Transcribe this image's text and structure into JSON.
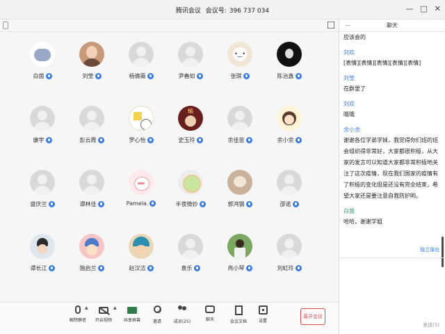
{
  "window": {
    "title_app": "腾讯会议",
    "title_label": "会议号:",
    "meeting_id": "396 737 034",
    "controls": [
      "—",
      "□",
      "✕"
    ]
  },
  "participants": [
    {
      "name": "白茵",
      "avatar": "elephant"
    },
    {
      "name": "刘莹",
      "avatar": "photo"
    },
    {
      "name": "杨倩薇",
      "avatar": "generic"
    },
    {
      "name": "尹春如",
      "avatar": "generic"
    },
    {
      "name": "张琪",
      "avatar": "dog"
    },
    {
      "name": "陈治鑫",
      "avatar": "dark"
    },
    {
      "name": "康宇",
      "avatar": "generic"
    },
    {
      "name": "彭云霞",
      "avatar": "generic"
    },
    {
      "name": "罗心怡",
      "avatar": "sketch"
    },
    {
      "name": "史玉玲",
      "avatar": "poster"
    },
    {
      "name": "余佳苗",
      "avatar": "generic"
    },
    {
      "name": "余小余",
      "avatar": "girlcartoon"
    },
    {
      "name": "盛庆兰",
      "avatar": "generic"
    },
    {
      "name": "谭林佳",
      "avatar": "generic"
    },
    {
      "name": "Pamela.",
      "avatar": "cartoon"
    },
    {
      "name": "半夜微妙",
      "avatar": "melon"
    },
    {
      "name": "郭鸿钢",
      "avatar": "cat"
    },
    {
      "name": "邵诺",
      "avatar": "generic"
    },
    {
      "name": "谭长江",
      "avatar": "boy"
    },
    {
      "name": "施启兰",
      "avatar": "kid"
    },
    {
      "name": "赵汉洁",
      "avatar": "hat"
    },
    {
      "name": "袁乐",
      "avatar": "generic"
    },
    {
      "name": "冉小琴",
      "avatar": "outdoor"
    },
    {
      "name": "刘虹玲",
      "avatar": "generic"
    }
  ],
  "toolbar": {
    "mute": "解除静音",
    "video": "开启视频",
    "share": "共享屏幕",
    "invite": "邀请",
    "members": "成员(25)",
    "chat": "聊天",
    "docs": "会议文档",
    "settings": "设置",
    "leave": "离开会议",
    "caret": "▲"
  },
  "chat": {
    "header": "聊天",
    "minimize": "—",
    "messages": [
      {
        "sender": "",
        "text": "应该会的"
      },
      {
        "sender": "刘欢",
        "text": "[表情][表情][表情][表情][表情]"
      },
      {
        "sender": "刘莹",
        "text": "在群里了"
      },
      {
        "sender": "刘欢",
        "text": "哦哦"
      },
      {
        "sender": "余小余",
        "text": "谢谢各位学弟学妹，我觉得你们班的班会组织得非常好，大家都很积极，从大家的发言可以知道大家都非常积极地关注了这次疫情，现在我们国家的疫情有了积极的变化但是还没有完全结束，希望大家还是要注意自我防护哟。"
      },
      {
        "sender": "白茵",
        "text": "哈哈，谢谢学姐"
      }
    ],
    "popout": "独立弹出",
    "send": "发送(S)"
  }
}
